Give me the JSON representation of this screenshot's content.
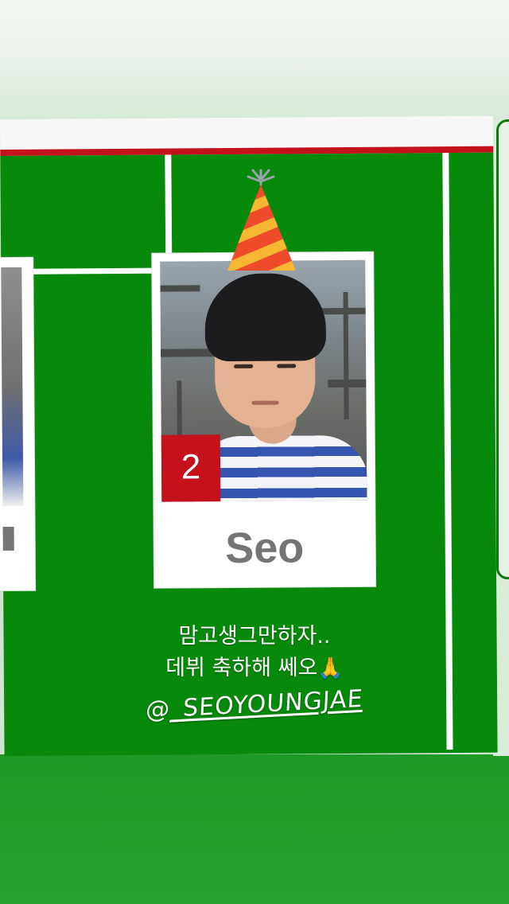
{
  "story": {
    "player_card": {
      "number": "2",
      "name": "Seo"
    },
    "caption": {
      "line1": "맘고생그만하자..",
      "line2": "데뷔 축하해 쎄오",
      "emoji": "🙏",
      "mention_at": "@",
      "mention_handle": "_SEOYOUNGJAE"
    },
    "stickers": {
      "party_hat": "party-hat-icon"
    },
    "colors": {
      "pitch": "#078a0b",
      "accent_red": "#c5111b",
      "name_gray": "#757575"
    }
  }
}
